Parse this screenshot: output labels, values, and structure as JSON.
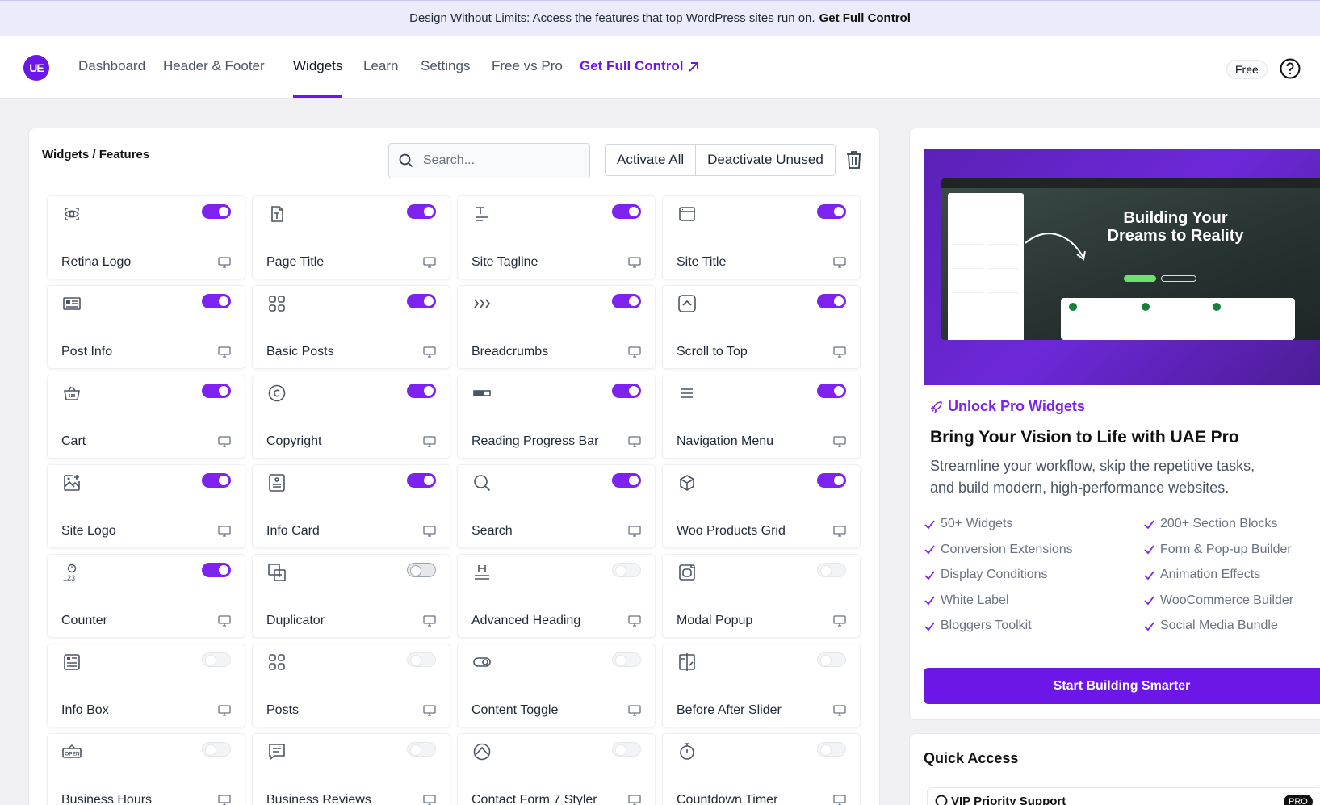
{
  "banner": {
    "text": "Design Without Limits: Access the features that top WordPress sites run on.",
    "link": "Get Full Control"
  },
  "nav": {
    "logo": "UE",
    "items": [
      "Dashboard",
      "Header & Footer",
      "Widgets",
      "Learn",
      "Settings",
      "Free vs Pro"
    ],
    "active": "Widgets",
    "promo": "Get Full Control",
    "plan_badge": "Free"
  },
  "widgets_panel": {
    "title": "Widgets / Features",
    "search_placeholder": "Search...",
    "activate_all": "Activate All",
    "deactivate_unused": "Deactivate Unused"
  },
  "widgets": [
    {
      "name": "Retina Logo",
      "icon": "eye-icon",
      "enabled": true
    },
    {
      "name": "Page Title",
      "icon": "page-title-icon",
      "enabled": true
    },
    {
      "name": "Site Tagline",
      "icon": "tagline-icon",
      "enabled": true
    },
    {
      "name": "Site Title",
      "icon": "browser-window-icon",
      "enabled": true
    },
    {
      "name": "Post Info",
      "icon": "post-info-icon",
      "enabled": true
    },
    {
      "name": "Basic Posts",
      "icon": "grid-icon",
      "enabled": true
    },
    {
      "name": "Breadcrumbs",
      "icon": "breadcrumbs-icon",
      "enabled": true
    },
    {
      "name": "Scroll to Top",
      "icon": "scroll-up-icon",
      "enabled": true
    },
    {
      "name": "Cart",
      "icon": "basket-icon",
      "enabled": true
    },
    {
      "name": "Copyright",
      "icon": "copyright-icon",
      "enabled": true
    },
    {
      "name": "Reading Progress Bar",
      "icon": "progress-bar-icon",
      "enabled": true
    },
    {
      "name": "Navigation Menu",
      "icon": "menu-icon",
      "enabled": true
    },
    {
      "name": "Site Logo",
      "icon": "image-add-icon",
      "enabled": true
    },
    {
      "name": "Info Card",
      "icon": "info-card-icon",
      "enabled": true
    },
    {
      "name": "Search",
      "icon": "search-icon",
      "enabled": true
    },
    {
      "name": "Woo Products Grid",
      "icon": "cube-icon",
      "enabled": true
    },
    {
      "name": "Counter",
      "icon": "counter-icon",
      "enabled": true
    },
    {
      "name": "Duplicator",
      "icon": "duplicate-icon",
      "enabled": false
    },
    {
      "name": "Advanced Heading",
      "icon": "heading-icon",
      "enabled": false
    },
    {
      "name": "Modal Popup",
      "icon": "modal-icon",
      "enabled": false
    },
    {
      "name": "Info Box",
      "icon": "info-box-icon",
      "enabled": false
    },
    {
      "name": "Posts",
      "icon": "grid-icon",
      "enabled": false
    },
    {
      "name": "Content Toggle",
      "icon": "toggle-icon",
      "enabled": false
    },
    {
      "name": "Before After Slider",
      "icon": "before-after-icon",
      "enabled": false
    },
    {
      "name": "Business Hours",
      "icon": "open-sign-icon",
      "enabled": false
    },
    {
      "name": "Business Reviews",
      "icon": "review-icon",
      "enabled": false
    },
    {
      "name": "Contact Form 7 Styler",
      "icon": "form-styler-icon",
      "enabled": false
    },
    {
      "name": "Countdown Timer",
      "icon": "stopwatch-icon",
      "enabled": false
    }
  ],
  "pro_panel": {
    "image_title": "Building Your Dreams to Reality",
    "unlock": "Unlock Pro Widgets",
    "heading": "Bring Your Vision to Life with UAE Pro",
    "description": "Streamline your workflow, skip the repetitive tasks, and build modern, high-performance websites.",
    "features_left": [
      "50+ Widgets",
      "Conversion Extensions",
      "Display Conditions",
      "White Label",
      "Bloggers Toolkit"
    ],
    "features_right": [
      "200+ Section Blocks",
      "Form & Pop-up Builder",
      "Animation Effects",
      "WooCommerce Builder",
      "Social Media Bundle"
    ],
    "cta": "Start Building Smarter"
  },
  "quick_access": {
    "title": "Quick Access",
    "first_item": "VIP Priority Support",
    "first_badge": "PRO"
  },
  "colors": {
    "accent": "#7e22f0",
    "brand": "#6d16e8",
    "banner_bg": "#ecebfb"
  }
}
